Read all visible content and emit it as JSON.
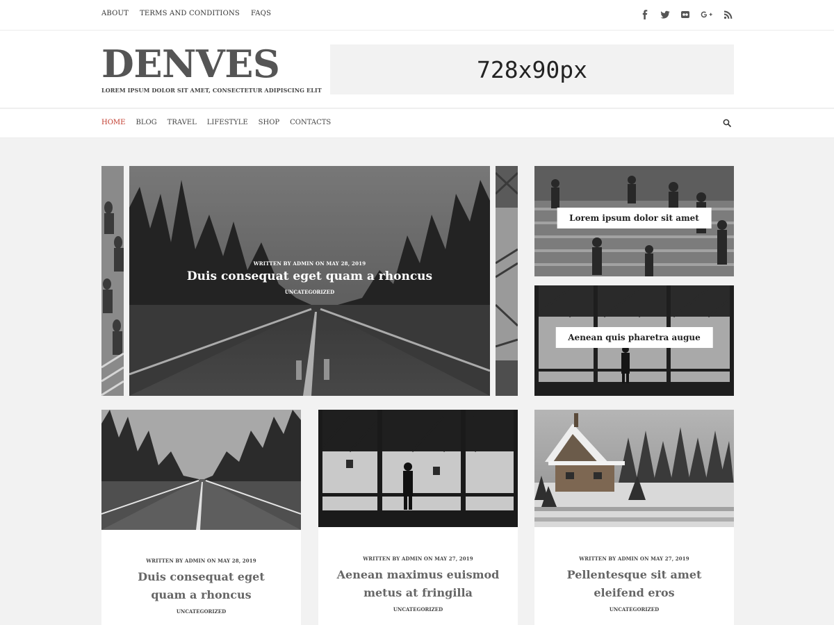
{
  "topbar": {
    "links": [
      "ABOUT",
      "TERMS AND CONDITIONS",
      "FAQS"
    ],
    "social_icons": [
      "facebook-icon",
      "twitter-icon",
      "flickr-icon",
      "google-plus-icon",
      "rss-icon"
    ]
  },
  "header": {
    "logo": "DENVES",
    "tagline": "LOREM IPSUM DOLOR SIT AMET, CONSECTETUR ADIPISCING ELIT",
    "ad_text": "728x90px"
  },
  "nav": {
    "items": [
      "HOME",
      "BLOG",
      "TRAVEL",
      "LIFESTYLE",
      "SHOP",
      "CONTACTS"
    ],
    "active": "HOME",
    "search_icon": "search-icon"
  },
  "slider": {
    "meta": "WRITTEN BY ADMIN ON MAY 28, 2019",
    "title": "Duis consequat eget quam a rhoncus",
    "category": "UNCATEGORIZED"
  },
  "side_features": [
    {
      "title": "Lorem ipsum dolor sit amet"
    },
    {
      "title": "Aenean quis pharetra augue"
    }
  ],
  "posts": [
    {
      "meta": "WRITTEN BY ADMIN ON MAY 28, 2019",
      "title": "Duis consequat eget quam a rhoncus",
      "category": "UNCATEGORIZED"
    },
    {
      "meta": "WRITTEN BY ADMIN ON MAY 27, 2019",
      "title": "Aenean maximus euismod metus at fringilla",
      "category": "UNCATEGORIZED"
    },
    {
      "meta": "WRITTEN BY ADMIN ON MAY 27, 2019",
      "title": "Pellentesque sit amet eleifend eros",
      "category": "UNCATEGORIZED"
    }
  ],
  "colors": {
    "accent": "#c0392b",
    "background": "#f2f2f2",
    "logo": "#555555"
  }
}
